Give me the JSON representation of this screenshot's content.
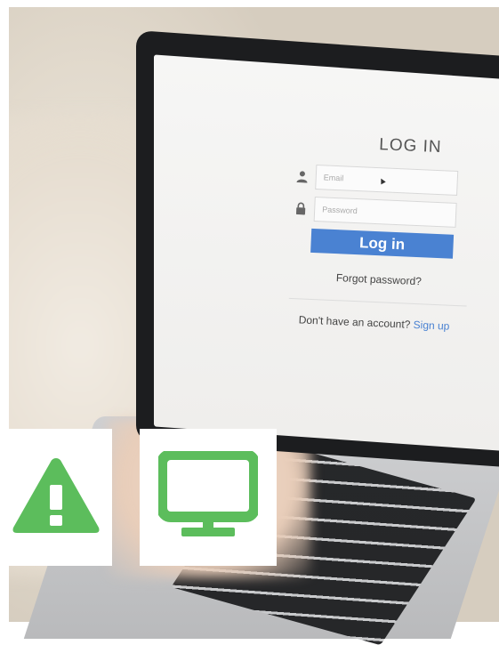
{
  "login": {
    "title": "LOG IN",
    "email_placeholder": "Email",
    "password_placeholder": "Password",
    "login_button": "Log in",
    "forgot_password": "Forgot password?",
    "no_account_text": "Don't have an account?",
    "signup_link": "Sign up"
  },
  "colors": {
    "accent": "#4a82d2",
    "icon_green": "#5cbd5c"
  },
  "icons": {
    "tile1": "warning-icon",
    "tile2": "monitor-icon"
  }
}
